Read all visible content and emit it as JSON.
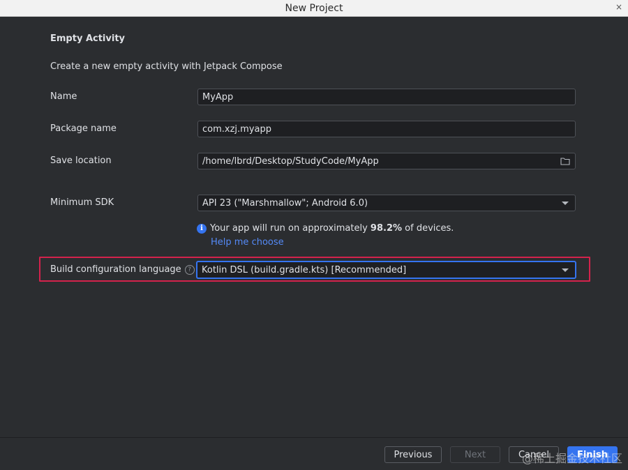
{
  "window": {
    "title": "New Project"
  },
  "form": {
    "heading": "Empty Activity",
    "description": "Create a new empty activity with Jetpack Compose",
    "name_label": "Name",
    "name_value": "MyApp",
    "package_label": "Package name",
    "package_value": "com.xzj.myapp",
    "location_label": "Save location",
    "location_value": "/home/lbrd/Desktop/StudyCode/MyApp",
    "min_sdk_label": "Minimum SDK",
    "min_sdk_value": "API 23 (\"Marshmallow\"; Android 6.0)",
    "info_prefix": "Your app will run on approximately ",
    "info_percent": "98.2%",
    "info_suffix": " of devices.",
    "help_link": "Help me choose",
    "build_lang_label": "Build configuration language",
    "build_lang_value": "Kotlin DSL (build.gradle.kts) [Recommended]"
  },
  "buttons": {
    "previous": "Previous",
    "next": "Next",
    "cancel": "Cancel",
    "finish": "Finish"
  },
  "watermark": "@稀土掘金技术社区",
  "colors": {
    "accent": "#3574f0",
    "highlight_box": "#d4224c",
    "link": "#548af7",
    "background": "#2b2d30"
  }
}
